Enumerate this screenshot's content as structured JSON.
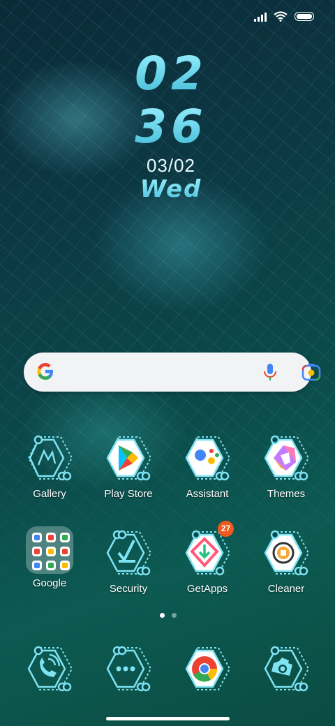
{
  "clock": {
    "hour": "02",
    "minute": "36",
    "date": "03/02",
    "day": "Wed"
  },
  "search": {
    "google_icon": "google-g-icon",
    "mic_icon": "mic-icon",
    "lens_icon": "lens-icon"
  },
  "apps": {
    "gallery": "Gallery",
    "play_store": "Play Store",
    "assistant": "Assistant",
    "themes": "Themes",
    "google": "Google",
    "security": "Security",
    "getapps": "GetApps",
    "getapps_badge": "27",
    "cleaner": "Cleaner"
  },
  "dock": [
    "phone-icon",
    "messages-icon",
    "chrome-icon",
    "camera-icon"
  ],
  "pager": {
    "pages": 2,
    "current": 1
  },
  "colors": {
    "accent": "#7ee3f2",
    "badge": "#ee5a1e"
  }
}
